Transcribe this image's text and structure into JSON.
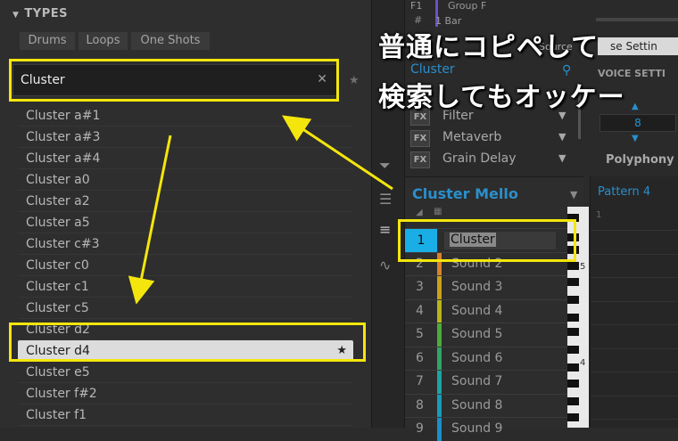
{
  "browser": {
    "types_header": "TYPES",
    "type_tabs": [
      "Drums",
      "Loops",
      "One Shots"
    ],
    "search": {
      "value": "Cluster",
      "clear_icon": "close-icon",
      "favorite_icon": "star-icon"
    },
    "results": [
      {
        "label": "Cluster a#1"
      },
      {
        "label": "Cluster a#3"
      },
      {
        "label": "Cluster a#4"
      },
      {
        "label": "Cluster a0"
      },
      {
        "label": "Cluster a2"
      },
      {
        "label": "Cluster a5"
      },
      {
        "label": "Cluster c#3"
      },
      {
        "label": "Cluster c0"
      },
      {
        "label": "Cluster c1"
      },
      {
        "label": "Cluster c5"
      },
      {
        "label": "Cluster d2"
      },
      {
        "label": "Cluster d4",
        "selected": true
      },
      {
        "label": "Cluster e5"
      },
      {
        "label": "Cluster f#2"
      },
      {
        "label": "Cluster f1"
      }
    ]
  },
  "plugin": {
    "group_row": {
      "key": "F1",
      "label": "Group F"
    },
    "bar_row": {
      "label": "1 Bar"
    },
    "source_label": "Source",
    "setting_label": "se Settin",
    "voice_label": "VOICE SETTI",
    "cluster_label": "Cluster",
    "effects": [
      {
        "badge": "FX",
        "name": "Filter"
      },
      {
        "badge": "FX",
        "name": "Metaverb"
      },
      {
        "badge": "FX",
        "name": "Grain Delay"
      }
    ],
    "polyphony_value": "8",
    "polyphony_label": "Polyphony"
  },
  "group": {
    "title": "Cluster Mello",
    "pattern_label": "Pattern 4",
    "pattern_ruler": "1",
    "pads": [
      {
        "num": "1",
        "name": "Cluster",
        "color": "#1aaee6",
        "editing": true
      },
      {
        "num": "2",
        "name": "Sound 2",
        "color": "#d9822b"
      },
      {
        "num": "3",
        "name": "Sound 3",
        "color": "#c9a21a"
      },
      {
        "num": "4",
        "name": "Sound 4",
        "color": "#b8b51a"
      },
      {
        "num": "5",
        "name": "Sound 5",
        "color": "#4cab3a"
      },
      {
        "num": "6",
        "name": "Sound 6",
        "color": "#2fa56a"
      },
      {
        "num": "7",
        "name": "Sound 7",
        "color": "#1ea4a0"
      },
      {
        "num": "8",
        "name": "Sound 8",
        "color": "#1a9ab8"
      },
      {
        "num": "9",
        "name": "Sound 9",
        "color": "#1a8fc8"
      }
    ],
    "key_labels": [
      "5",
      "4"
    ]
  },
  "annotation": {
    "line1": "普通にコピペして",
    "line2": "検索してもオッケー",
    "highlight_color": "#f4e60c"
  }
}
